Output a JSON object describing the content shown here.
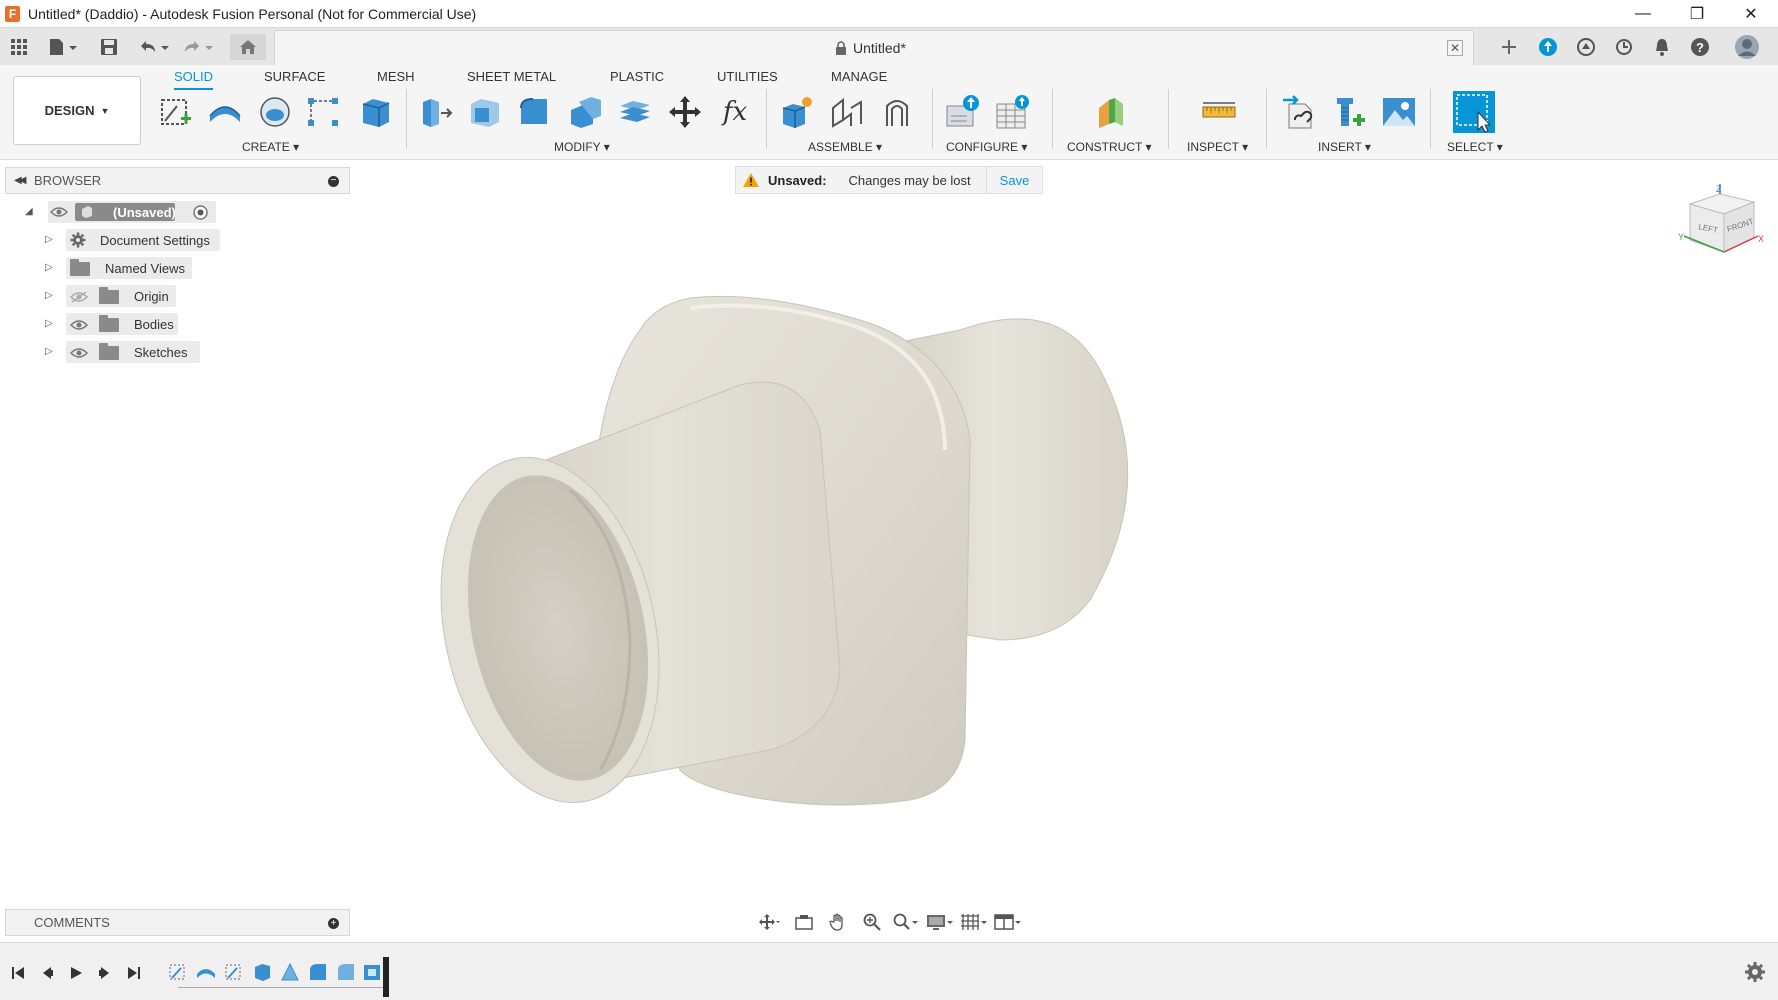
{
  "titlebar": {
    "logo_letter": "F",
    "title": "Untitled* (Daddio) - Autodesk Fusion Personal (Not for Commercial Use)",
    "minimize": "—",
    "restore": "❐",
    "close": "✕"
  },
  "document_tab": {
    "label": "Untitled*",
    "close": "✕"
  },
  "toolbar": {
    "workspace": "DESIGN",
    "tabs": [
      "SOLID",
      "SURFACE",
      "MESH",
      "SHEET METAL",
      "PLASTIC",
      "UTILITIES",
      "MANAGE"
    ],
    "active_tab": "SOLID",
    "groups": [
      "CREATE",
      "MODIFY",
      "ASSEMBLE",
      "CONFIGURE",
      "CONSTRUCT",
      "INSPECT",
      "INSERT",
      "SELECT"
    ],
    "fx_label": "fx"
  },
  "browser": {
    "title": "BROWSER",
    "root": "(Unsaved)",
    "items": [
      {
        "label": "Document Settings",
        "icon": "gear-icon"
      },
      {
        "label": "Named Views",
        "icon": "folder-icon"
      },
      {
        "label": "Origin",
        "icon": "folder-icon",
        "visibility": "hidden"
      },
      {
        "label": "Bodies",
        "icon": "folder-icon",
        "visibility": "visible"
      },
      {
        "label": "Sketches",
        "icon": "folder-icon",
        "visibility": "visible"
      }
    ]
  },
  "banner": {
    "status": "Unsaved:",
    "message": "Changes may be lost",
    "action": "Save"
  },
  "comments": {
    "title": "COMMENTS"
  },
  "viewcube": {
    "left": "LEFT",
    "front": "FRONT",
    "axis_z": "Z",
    "axis_x": "X",
    "axis_y": "Y"
  },
  "colors": {
    "accent": "#0696d7",
    "model_fill": "#e4e1d8",
    "warning": "#f0a30a"
  }
}
